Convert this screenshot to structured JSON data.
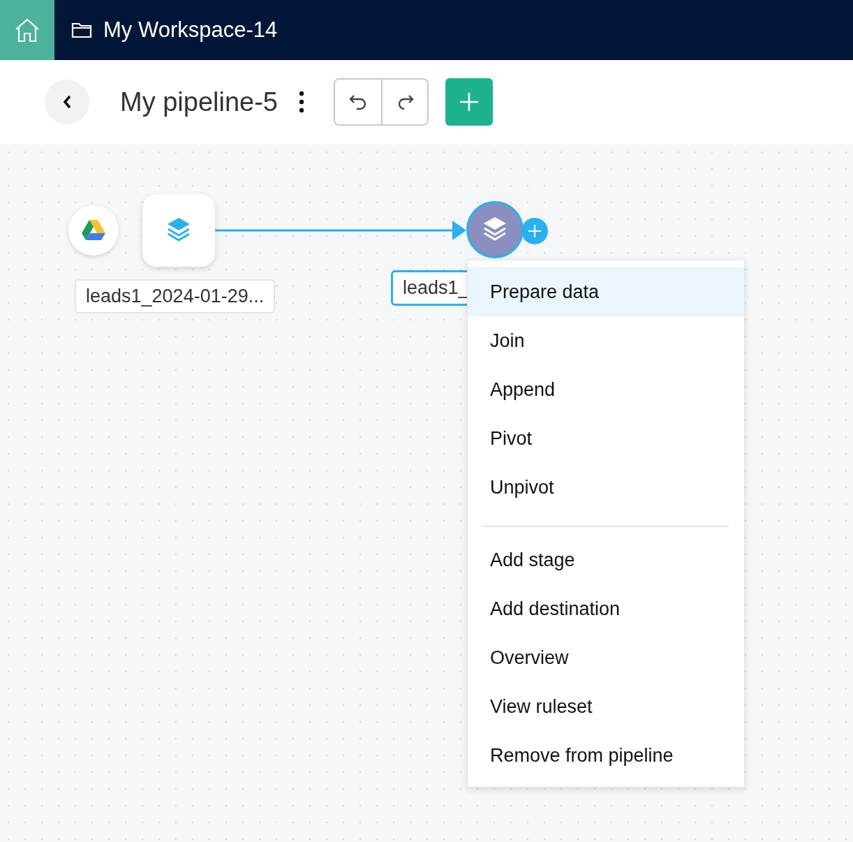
{
  "header": {
    "workspace": "My Workspace-14"
  },
  "toolbar": {
    "title": "My pipeline-5"
  },
  "canvas": {
    "nodes": [
      {
        "kind": "source",
        "label": "leads1_2024-01-29...",
        "selected": false
      },
      {
        "kind": "stage",
        "label": "leads1_",
        "selected": true
      }
    ]
  },
  "menu": {
    "groups": [
      {
        "items": [
          {
            "label": "Prepare data",
            "selected": true
          },
          {
            "label": "Join",
            "selected": false
          },
          {
            "label": "Append",
            "selected": false
          },
          {
            "label": "Pivot",
            "selected": false
          },
          {
            "label": "Unpivot",
            "selected": false
          }
        ]
      },
      {
        "items": [
          {
            "label": "Add stage",
            "selected": false
          },
          {
            "label": "Add destination",
            "selected": false
          },
          {
            "label": "Overview",
            "selected": false
          },
          {
            "label": "View ruleset",
            "selected": false
          },
          {
            "label": "Remove from pipeline",
            "selected": false
          }
        ]
      }
    ]
  }
}
